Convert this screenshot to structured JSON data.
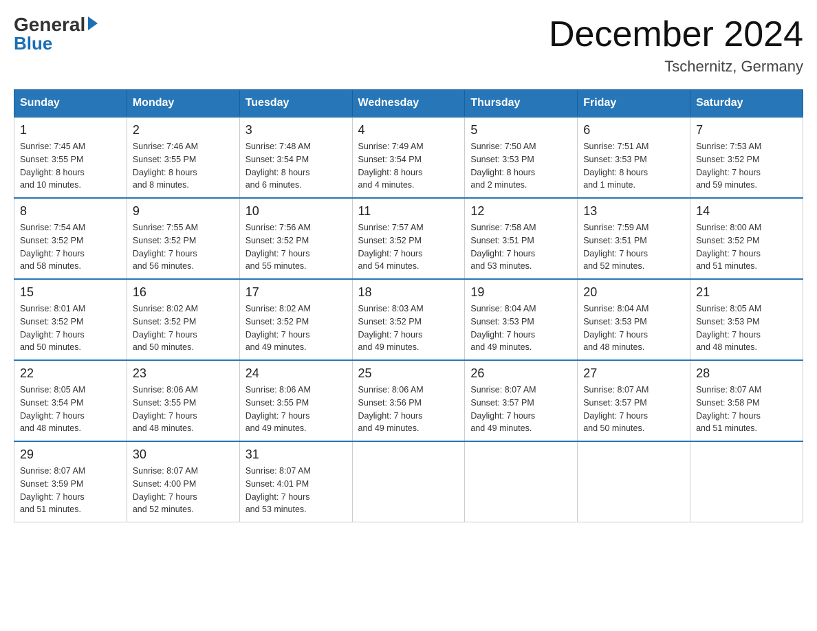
{
  "header": {
    "logo_general": "General",
    "logo_blue": "Blue",
    "month_title": "December 2024",
    "location": "Tschernitz, Germany"
  },
  "days_of_week": [
    "Sunday",
    "Monday",
    "Tuesday",
    "Wednesday",
    "Thursday",
    "Friday",
    "Saturday"
  ],
  "weeks": [
    [
      {
        "day": "1",
        "sunrise": "7:45 AM",
        "sunset": "3:55 PM",
        "daylight": "8 hours and 10 minutes."
      },
      {
        "day": "2",
        "sunrise": "7:46 AM",
        "sunset": "3:55 PM",
        "daylight": "8 hours and 8 minutes."
      },
      {
        "day": "3",
        "sunrise": "7:48 AM",
        "sunset": "3:54 PM",
        "daylight": "8 hours and 6 minutes."
      },
      {
        "day": "4",
        "sunrise": "7:49 AM",
        "sunset": "3:54 PM",
        "daylight": "8 hours and 4 minutes."
      },
      {
        "day": "5",
        "sunrise": "7:50 AM",
        "sunset": "3:53 PM",
        "daylight": "8 hours and 2 minutes."
      },
      {
        "day": "6",
        "sunrise": "7:51 AM",
        "sunset": "3:53 PM",
        "daylight": "8 hours and 1 minute."
      },
      {
        "day": "7",
        "sunrise": "7:53 AM",
        "sunset": "3:52 PM",
        "daylight": "7 hours and 59 minutes."
      }
    ],
    [
      {
        "day": "8",
        "sunrise": "7:54 AM",
        "sunset": "3:52 PM",
        "daylight": "7 hours and 58 minutes."
      },
      {
        "day": "9",
        "sunrise": "7:55 AM",
        "sunset": "3:52 PM",
        "daylight": "7 hours and 56 minutes."
      },
      {
        "day": "10",
        "sunrise": "7:56 AM",
        "sunset": "3:52 PM",
        "daylight": "7 hours and 55 minutes."
      },
      {
        "day": "11",
        "sunrise": "7:57 AM",
        "sunset": "3:52 PM",
        "daylight": "7 hours and 54 minutes."
      },
      {
        "day": "12",
        "sunrise": "7:58 AM",
        "sunset": "3:51 PM",
        "daylight": "7 hours and 53 minutes."
      },
      {
        "day": "13",
        "sunrise": "7:59 AM",
        "sunset": "3:51 PM",
        "daylight": "7 hours and 52 minutes."
      },
      {
        "day": "14",
        "sunrise": "8:00 AM",
        "sunset": "3:52 PM",
        "daylight": "7 hours and 51 minutes."
      }
    ],
    [
      {
        "day": "15",
        "sunrise": "8:01 AM",
        "sunset": "3:52 PM",
        "daylight": "7 hours and 50 minutes."
      },
      {
        "day": "16",
        "sunrise": "8:02 AM",
        "sunset": "3:52 PM",
        "daylight": "7 hours and 50 minutes."
      },
      {
        "day": "17",
        "sunrise": "8:02 AM",
        "sunset": "3:52 PM",
        "daylight": "7 hours and 49 minutes."
      },
      {
        "day": "18",
        "sunrise": "8:03 AM",
        "sunset": "3:52 PM",
        "daylight": "7 hours and 49 minutes."
      },
      {
        "day": "19",
        "sunrise": "8:04 AM",
        "sunset": "3:53 PM",
        "daylight": "7 hours and 49 minutes."
      },
      {
        "day": "20",
        "sunrise": "8:04 AM",
        "sunset": "3:53 PM",
        "daylight": "7 hours and 48 minutes."
      },
      {
        "day": "21",
        "sunrise": "8:05 AM",
        "sunset": "3:53 PM",
        "daylight": "7 hours and 48 minutes."
      }
    ],
    [
      {
        "day": "22",
        "sunrise": "8:05 AM",
        "sunset": "3:54 PM",
        "daylight": "7 hours and 48 minutes."
      },
      {
        "day": "23",
        "sunrise": "8:06 AM",
        "sunset": "3:55 PM",
        "daylight": "7 hours and 48 minutes."
      },
      {
        "day": "24",
        "sunrise": "8:06 AM",
        "sunset": "3:55 PM",
        "daylight": "7 hours and 49 minutes."
      },
      {
        "day": "25",
        "sunrise": "8:06 AM",
        "sunset": "3:56 PM",
        "daylight": "7 hours and 49 minutes."
      },
      {
        "day": "26",
        "sunrise": "8:07 AM",
        "sunset": "3:57 PM",
        "daylight": "7 hours and 49 minutes."
      },
      {
        "day": "27",
        "sunrise": "8:07 AM",
        "sunset": "3:57 PM",
        "daylight": "7 hours and 50 minutes."
      },
      {
        "day": "28",
        "sunrise": "8:07 AM",
        "sunset": "3:58 PM",
        "daylight": "7 hours and 51 minutes."
      }
    ],
    [
      {
        "day": "29",
        "sunrise": "8:07 AM",
        "sunset": "3:59 PM",
        "daylight": "7 hours and 51 minutes."
      },
      {
        "day": "30",
        "sunrise": "8:07 AM",
        "sunset": "4:00 PM",
        "daylight": "7 hours and 52 minutes."
      },
      {
        "day": "31",
        "sunrise": "8:07 AM",
        "sunset": "4:01 PM",
        "daylight": "7 hours and 53 minutes."
      },
      null,
      null,
      null,
      null
    ]
  ],
  "labels": {
    "sunrise": "Sunrise:",
    "sunset": "Sunset:",
    "daylight": "Daylight:"
  }
}
